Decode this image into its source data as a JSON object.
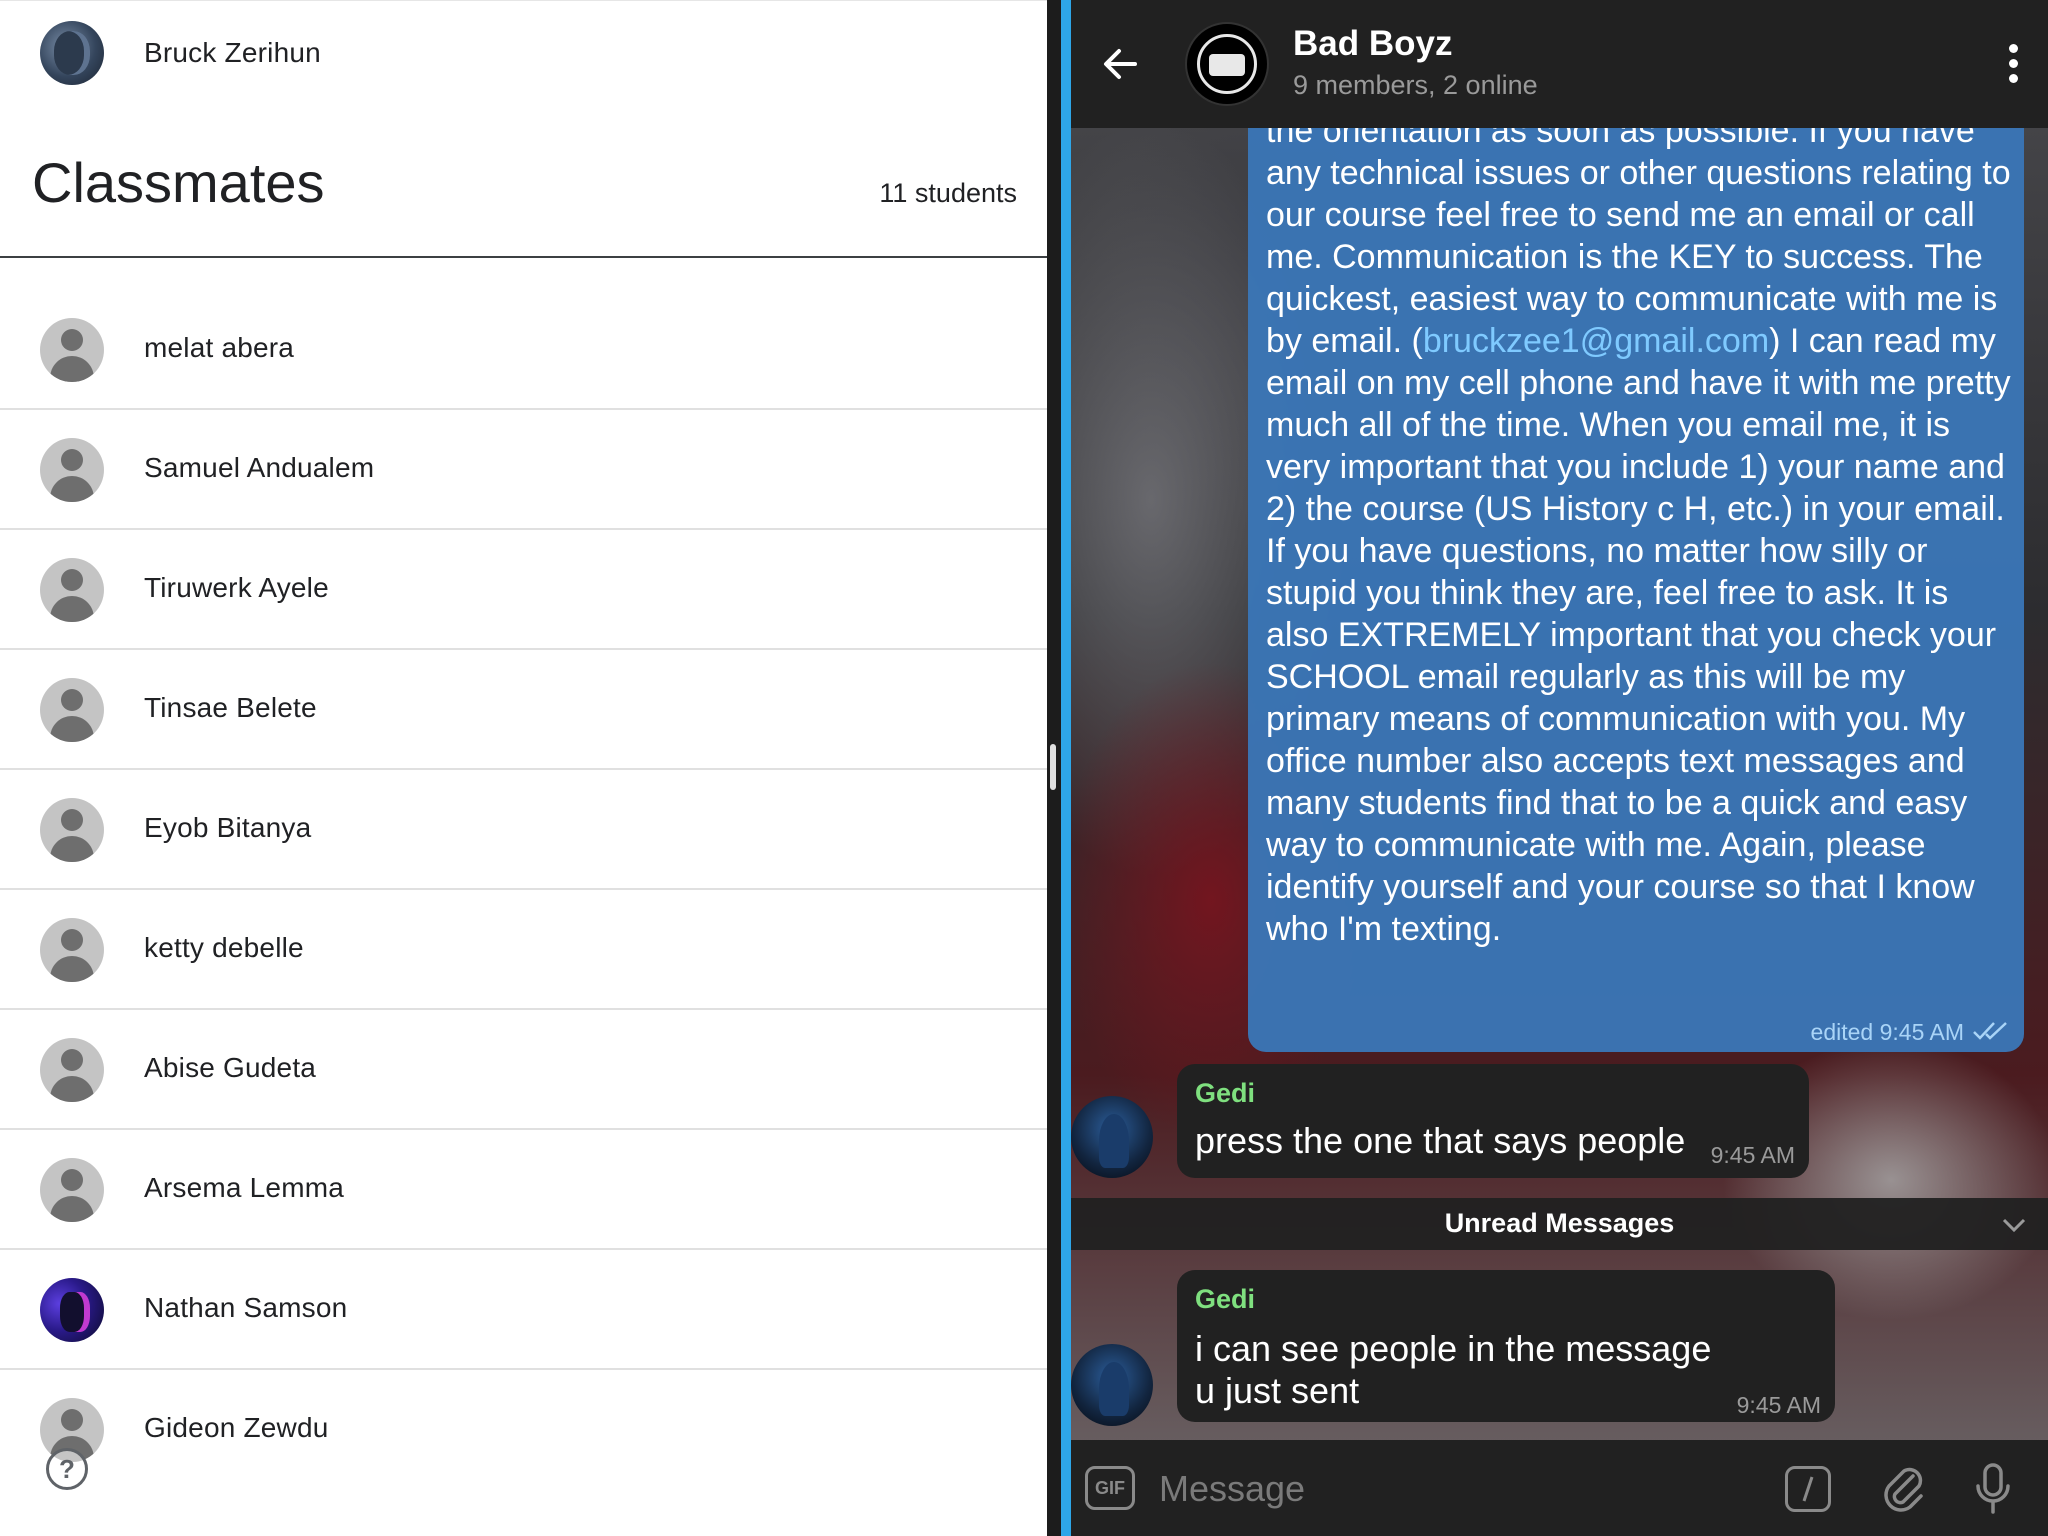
{
  "classroom": {
    "teacher": {
      "name": "Bruck Zerihun"
    },
    "section_title": "Classmates",
    "student_count": "11 students",
    "students": [
      {
        "name": "melat abera",
        "avatar": "generic"
      },
      {
        "name": "Samuel Andualem",
        "avatar": "generic"
      },
      {
        "name": "Tiruwerk Ayele",
        "avatar": "generic"
      },
      {
        "name": "Tinsae Belete",
        "avatar": "generic"
      },
      {
        "name": "Eyob Bitanya",
        "avatar": "generic"
      },
      {
        "name": "ketty debelle",
        "avatar": "generic"
      },
      {
        "name": "Abise Gudeta",
        "avatar": "generic"
      },
      {
        "name": "Arsema Lemma",
        "avatar": "generic"
      },
      {
        "name": "Nathan Samson",
        "avatar": "photo"
      },
      {
        "name": "Gideon Zewdu",
        "avatar": "generic"
      }
    ],
    "help_icon": "?"
  },
  "chat": {
    "header": {
      "title": "Bad Boyz",
      "subtitle": "9 members, 2 online"
    },
    "outgoing_message": {
      "text_before_link": "the orientation as soon as possible. If you have any technical issues or other questions relating to our course feel free to send me an email or call me. Communication is the KEY to success. The quickest, easiest way to communicate with me is by email. (",
      "link": "bruckzee1@gmail.com",
      "text_after_link": ") I can read my email on my cell phone and have it with me pretty much all of the time. When you email me, it is very important that you include 1) your name and 2) the course (US History c H, etc.) in your email. If you have questions, no matter how silly or stupid you think they are, feel free to ask. It is also EXTREMELY important that you check your SCHOOL email regularly as this will be my primary means of communication with you. My office number also accepts text messages and many students find that to be a quick and easy way to communicate with me. Again, please identify yourself and your course so that I know who I'm texting.",
      "meta": "edited 9:45 AM"
    },
    "incoming_messages": [
      {
        "sender": "Gedi",
        "text": "press the one that says people",
        "time": "9:45 AM"
      },
      {
        "sender": "Gedi",
        "text": "i can see people in the message u just sent",
        "time": "9:45 AM"
      }
    ],
    "unread_label": "Unread Messages",
    "composer": {
      "gif_label": "GIF",
      "placeholder": "Message"
    }
  },
  "colors": {
    "accent": "#2ea6e8",
    "outgoing_bubble": "#3a76b6",
    "link": "#7fcaff",
    "sender_name": "#7fe07f",
    "chat_header": "#212121"
  }
}
